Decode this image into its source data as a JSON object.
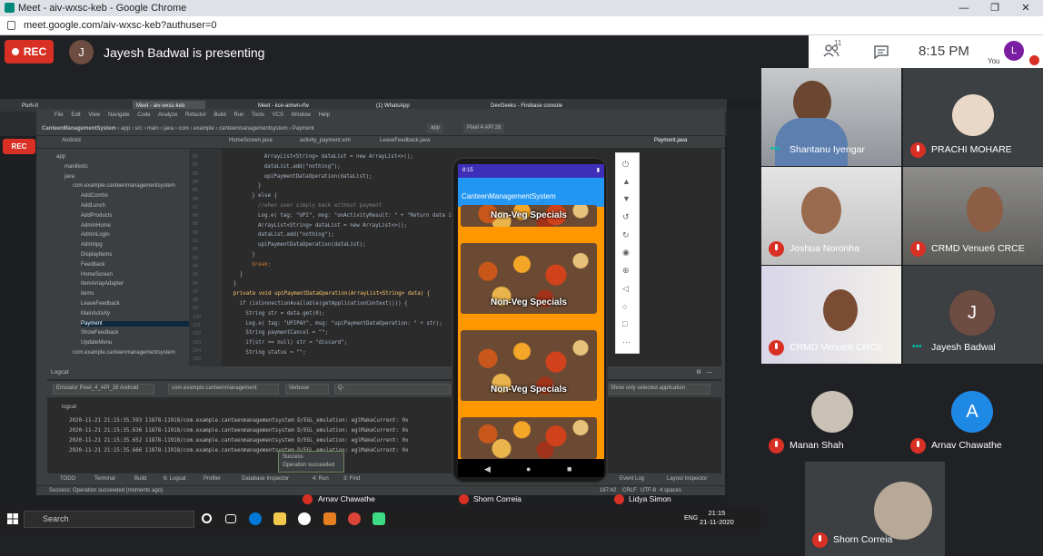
{
  "browser": {
    "window_title": "Meet - aiv-wxsc-keb - Google Chrome",
    "url": "meet.google.com/aiv-wxsc-keb?authuser=0"
  },
  "meet": {
    "rec_label": "REC",
    "presenter_initial": "J",
    "presenter_text": "Jayesh Badwal is presenting",
    "participant_count": "11",
    "time": "8:15 PM",
    "self_initial": "L",
    "self_label": "You"
  },
  "participants": [
    {
      "name": "Shantanu Iyengar",
      "status": "speaking"
    },
    {
      "name": "PRACHI MOHARE",
      "status": "muted"
    },
    {
      "name": "Joshua Noronha",
      "status": "muted"
    },
    {
      "name": "CRMD Venue6 CRCE",
      "status": "muted"
    },
    {
      "name": "CRMD Venue6 CRCE",
      "status": "muted"
    },
    {
      "name": "Jayesh Badwal",
      "status": "speaking",
      "initial": "J"
    },
    {
      "name": "Manan Shah",
      "status": "muted"
    },
    {
      "name": "Arnav Chawathe",
      "status": "muted",
      "initial": "A"
    },
    {
      "name": "Shorn Correia",
      "status": "muted"
    }
  ],
  "shared_screen": {
    "inner_tabs": [
      "Purh-II",
      "Meet - aiv-wxsc-keb",
      "Meet - kce-amwn-rfw",
      "(1) WhatsApp",
      "DevGeeks - Firebase console"
    ],
    "inner_rec": "REC",
    "studio": {
      "menu": [
        "File",
        "Edit",
        "View",
        "Navigate",
        "Code",
        "Analyze",
        "Refactor",
        "Build",
        "Run",
        "Tools",
        "VCS",
        "Window",
        "Help"
      ],
      "breadcrumb": [
        "CanteenManagementSystem",
        "app",
        "src",
        "main",
        "java",
        "com",
        "example",
        "canteenmanagementsystem",
        "Payment"
      ],
      "run_config": "app",
      "device": "Pixel 4 API 28",
      "file_tabs": [
        "HomeScreen.java",
        "activity_payment.xml",
        "LeaveFeedback.java",
        "Payment.java"
      ],
      "project_view": "Android",
      "tree": [
        {
          "label": "app",
          "indent": 0
        },
        {
          "label": "manifests",
          "indent": 1
        },
        {
          "label": "java",
          "indent": 1
        },
        {
          "label": "com.example.canteenmanagementsystem",
          "indent": 2
        },
        {
          "label": "AddCombo",
          "indent": 3
        },
        {
          "label": "AddLunch",
          "indent": 3
        },
        {
          "label": "AddProducts",
          "indent": 3
        },
        {
          "label": "AdminHome",
          "indent": 3
        },
        {
          "label": "AdminLogin",
          "indent": 3
        },
        {
          "label": "Adminpg",
          "indent": 3
        },
        {
          "label": "DisplayItems",
          "indent": 3
        },
        {
          "label": "Feedback",
          "indent": 3
        },
        {
          "label": "HomeScreen",
          "indent": 3
        },
        {
          "label": "ItemArrayAdapter",
          "indent": 3
        },
        {
          "label": "items",
          "indent": 3
        },
        {
          "label": "LeaveFeedback",
          "indent": 3
        },
        {
          "label": "MainActivity",
          "indent": 3
        },
        {
          "label": "Payment",
          "indent": 3,
          "selected": true
        },
        {
          "label": "ShowFeedback",
          "indent": 3
        },
        {
          "label": "UpdateMenu",
          "indent": 3
        },
        {
          "label": "com.example.canteenmanagementsystem",
          "indent": 2
        }
      ],
      "line_numbers": [
        "81",
        "82",
        "83",
        "84",
        "85",
        "86",
        "87",
        "88",
        "89",
        "90",
        "91",
        "92",
        "93",
        "94",
        "95",
        "96",
        "97",
        "98",
        "99",
        "100",
        "101",
        "102",
        "103",
        "104",
        "105",
        "106"
      ],
      "code_lines": [
        {
          "indent": 12,
          "text": "ArrayList<String> dataList = new ArrayList<>();",
          "cls": ""
        },
        {
          "indent": 12,
          "text": "dataList.add(\"nothing\");",
          "cls": ""
        },
        {
          "indent": 12,
          "text": "upiPaymentDataOperation(dataList);",
          "cls": ""
        },
        {
          "indent": 10,
          "text": "}",
          "cls": ""
        },
        {
          "indent": 8,
          "text": "} else {",
          "cls": ""
        },
        {
          "indent": 10,
          "text": "//when user simply back without payment",
          "cls": "cm"
        },
        {
          "indent": 10,
          "text": "Log.e( tag: \"UPI\",  msg: \"onActivityResult: \" + \"Return data is null\");",
          "cls": ""
        },
        {
          "indent": 10,
          "text": "ArrayList<String> dataList = new ArrayList<>();",
          "cls": ""
        },
        {
          "indent": 10,
          "text": "dataList.add(\"nothing\");",
          "cls": ""
        },
        {
          "indent": 10,
          "text": "upiPaymentDataOperation(dataList);",
          "cls": ""
        },
        {
          "indent": 8,
          "text": "}",
          "cls": ""
        },
        {
          "indent": 8,
          "text": "break;",
          "cls": "kw"
        },
        {
          "indent": 4,
          "text": "}",
          "cls": ""
        },
        {
          "indent": 2,
          "text": "}",
          "cls": ""
        },
        {
          "indent": 2,
          "text": "private void upiPaymentDataOperation(ArrayList<String> data) {",
          "cls": "fn"
        },
        {
          "indent": 4,
          "text": "if (isConnectionAvailable(getApplicationContext())) {",
          "cls": ""
        },
        {
          "indent": 6,
          "text": "String str = data.get(0);",
          "cls": ""
        },
        {
          "indent": 6,
          "text": "Log.e( tag: \"UPIPAY\",  msg: \"upiPaymentDataOperation: \" + str);",
          "cls": ""
        },
        {
          "indent": 6,
          "text": "String paymentCancel = \"\";",
          "cls": ""
        },
        {
          "indent": 6,
          "text": "if(str == null) str = \"discard\";",
          "cls": ""
        },
        {
          "indent": 6,
          "text": "String status = \"\";",
          "cls": ""
        }
      ],
      "logcat": {
        "title": "Logcat",
        "device": "Emulator Pixel_4_API_28 Android",
        "package": "com.example.canteenmanagement",
        "level": "Verbose",
        "search_placeholder": "Q-",
        "filter": "Show only selected application",
        "sub_tab": "logcat",
        "lines": [
          "2020-11-21 21:15:35.593 11878-11918/com.example.canteenmanagementsystem D/EGL_emulation: eglMakeCurrent: 0x",
          "2020-11-21 21:15:35.636 11878-11918/com.example.canteenmanagementsystem D/EGL_emulation: eglMakeCurrent: 0x",
          "2020-11-21 21:15:35.652 11878-11918/com.example.canteenmanagementsystem D/EGL_emulation: eglMakeCurrent: 0x",
          "2020-11-21 21:15:35.666 11878-11918/com.example.canteenmanagementsystem D/EGL_emulation: eglMakeCurrent: 0x"
        ]
      },
      "bottom_tools": [
        "TODO",
        "Terminal",
        "Build",
        "6: Logcat",
        "Profiler",
        "Database Inspector",
        "4: Run",
        "3: Find",
        "Event Log",
        "Layout Inspector"
      ],
      "status_text": "Success: Operation succeeded (moments ago)",
      "status_right": [
        "167:42",
        "CRLF",
        "UTF-8",
        "4 spaces"
      ],
      "tooltip_title": "Success",
      "tooltip_body": "Operation succeeded"
    },
    "phone": {
      "status_time": "8:15",
      "app_title": "CanteenManagementSystem",
      "card_label": "Non-Veg Specials"
    },
    "bottom_names": [
      "Arnav Chawathe",
      "Shorn Correia",
      "Lidya Simon"
    ]
  },
  "taskbar": {
    "search_placeholder": "Search",
    "lang": "ENG",
    "time": "21:15",
    "date": "21-11-2020"
  },
  "colors": {
    "meet_bg": "#202124",
    "rec": "#d93025",
    "phone_appbar": "#2196f3",
    "phone_status": "#3f2fb8",
    "phone_content": "#ff9800"
  }
}
